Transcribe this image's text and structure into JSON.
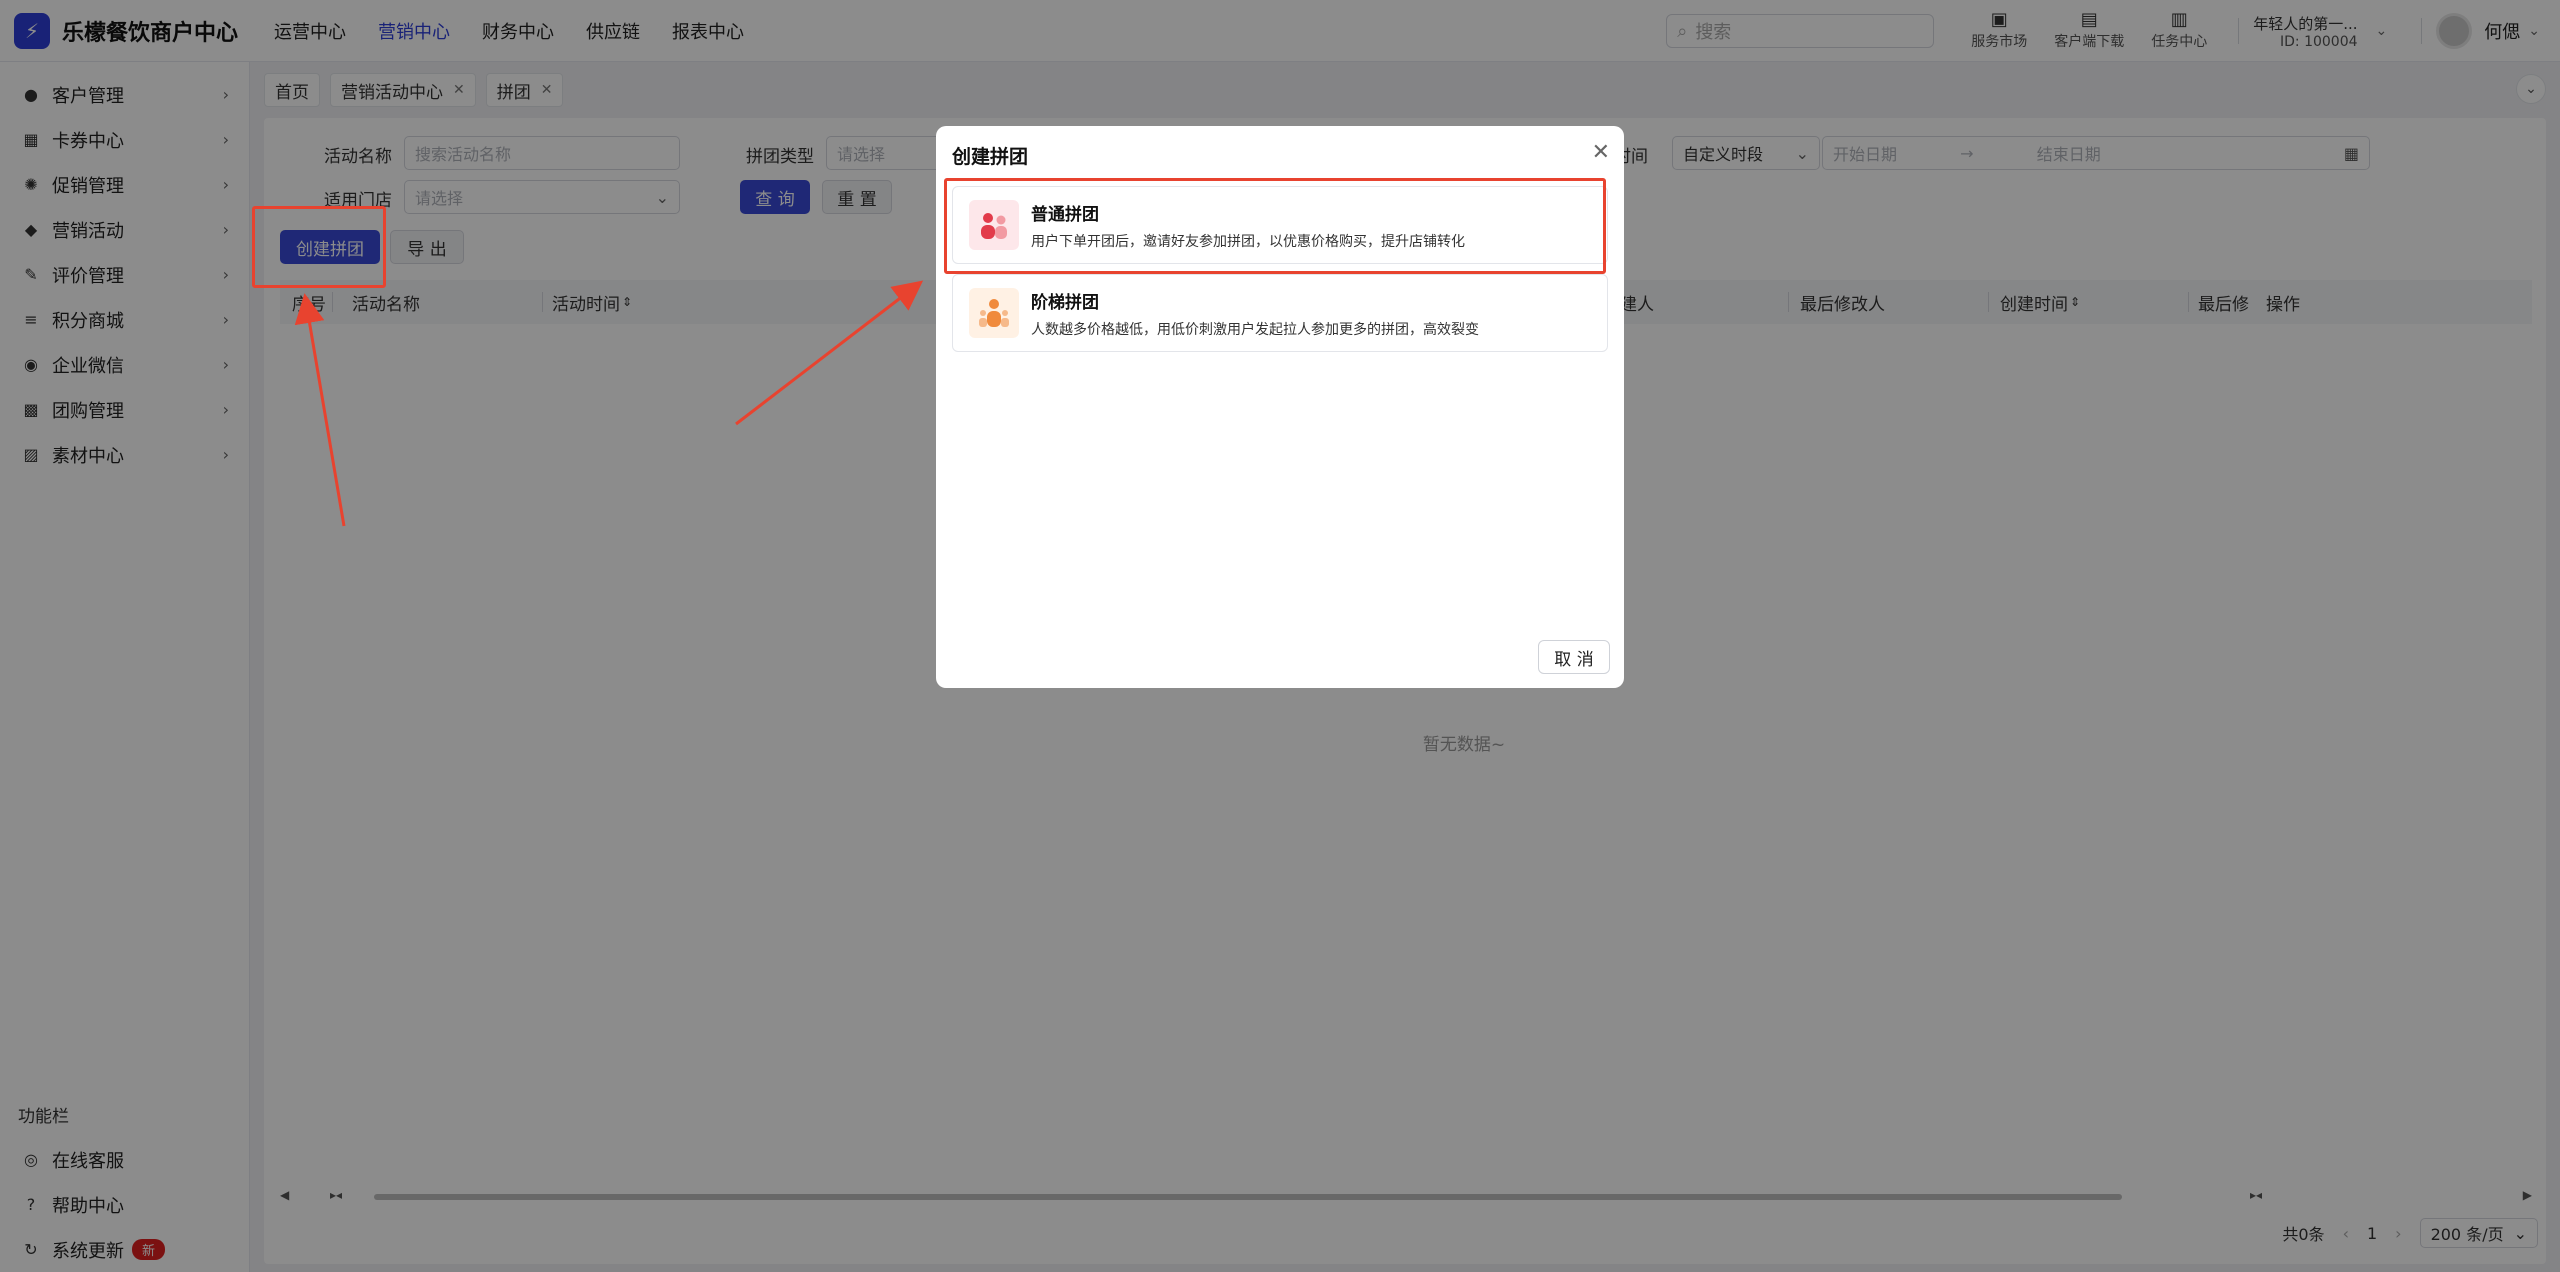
{
  "brand": {
    "name": "乐檬餐饮商户中心",
    "logo_glyph": "⚡"
  },
  "topnav": [
    {
      "label": "运营中心",
      "active": false
    },
    {
      "label": "营销中心",
      "active": true
    },
    {
      "label": "财务中心",
      "active": false
    },
    {
      "label": "供应链",
      "active": false
    },
    {
      "label": "报表中心",
      "active": false
    }
  ],
  "search": {
    "placeholder": "搜索"
  },
  "top_actions": [
    {
      "label": "服务市场",
      "icon": "store-icon"
    },
    {
      "label": "客户端下载",
      "icon": "download-folder-icon"
    },
    {
      "label": "任务中心",
      "icon": "clipboard-icon"
    }
  ],
  "account": {
    "name": "年轻人的第一...",
    "id": "ID: 100004",
    "user": "何偲"
  },
  "sidebar": {
    "items": [
      {
        "label": "客户管理",
        "icon": "user-icon"
      },
      {
        "label": "卡券中心",
        "icon": "ticket-icon"
      },
      {
        "label": "促销管理",
        "icon": "gear-icon"
      },
      {
        "label": "营销活动",
        "icon": "tag-icon"
      },
      {
        "label": "评价管理",
        "icon": "review-icon"
      },
      {
        "label": "积分商城",
        "icon": "coins-icon"
      },
      {
        "label": "企业微信",
        "icon": "chat-icon"
      },
      {
        "label": "团购管理",
        "icon": "shop-icon"
      },
      {
        "label": "素材中心",
        "icon": "image-icon"
      }
    ],
    "func_title": "功能栏",
    "func_items": [
      {
        "label": "在线客服",
        "icon": "headset-icon"
      },
      {
        "label": "帮助中心",
        "icon": "help-icon"
      },
      {
        "label": "系统更新",
        "icon": "refresh-icon",
        "badge": "新"
      }
    ]
  },
  "tabs": [
    {
      "label": "首页",
      "closable": false
    },
    {
      "label": "营销活动中心",
      "closable": true
    },
    {
      "label": "拼团",
      "closable": true
    }
  ],
  "filters": {
    "name_label": "活动名称",
    "name_placeholder": "搜索活动名称",
    "type_label": "拼团类型",
    "type_placeholder": "请选择",
    "store_label": "适用门店",
    "store_placeholder": "请选择",
    "time_label": "时间",
    "time_value": "自定义时段",
    "start_placeholder": "开始日期",
    "end_placeholder": "结束日期",
    "query": "查 询",
    "reset": "重 置"
  },
  "actions": {
    "create": "创建拼团",
    "export": "导 出"
  },
  "table": {
    "columns": [
      "序号",
      "活动名称",
      "活动时间",
      "建人",
      "最后修改人",
      "创建时间",
      "最后修",
      "操作"
    ],
    "empty": "暂无数据~"
  },
  "pager": {
    "total": "共0条",
    "page": "1",
    "size": "200 条/页"
  },
  "modal": {
    "title": "创建拼团",
    "options": [
      {
        "title": "普通拼团",
        "desc": "用户下单开团后，邀请好友参加拼团，以优惠价格购买，提升店铺转化"
      },
      {
        "title": "阶梯拼团",
        "desc": "人数越多价格越低，用低价刺激用户发起拉人参加更多的拼团，高效裂变"
      }
    ],
    "cancel": "取 消"
  },
  "colors": {
    "primary": "#3a4ad8",
    "annotation": "#e8432f",
    "badge": "#e02020"
  }
}
